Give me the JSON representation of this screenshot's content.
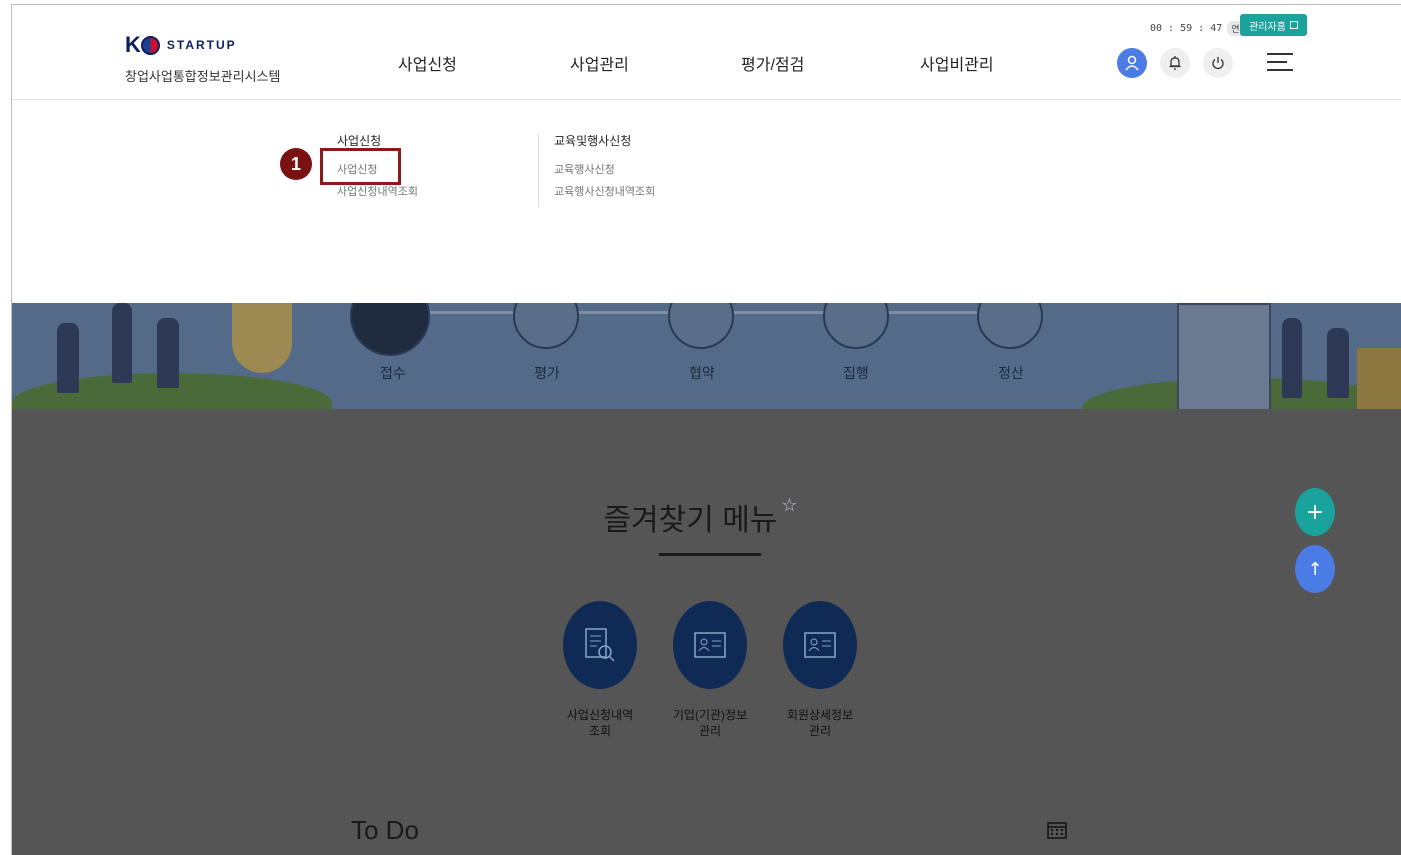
{
  "header": {
    "logo_k": "K",
    "logo_word": "STARTUP",
    "subtitle": "창업사업통합정보관리시스템",
    "nav": [
      "사업신청",
      "사업관리",
      "평가/점검",
      "사업비관리"
    ],
    "timer": "00 : 59 : 47",
    "extend_label": "연장",
    "admin_label": "관리자홈"
  },
  "dropdown": {
    "col1_title": "사업신청",
    "col1_items": [
      "사업신청",
      "사업신청내역조회"
    ],
    "col2_title": "교육및행사신청",
    "col2_items": [
      "교육행사신청",
      "교육행사신청내역조회"
    ],
    "step_badge": "1"
  },
  "banner": {
    "steps": [
      "접수",
      "평가",
      "협약",
      "집행",
      "정산"
    ]
  },
  "favorites": {
    "title": "즐겨찾기 메뉴",
    "star": "☆",
    "items": [
      {
        "line1": "사업신청내역",
        "line2": "조회"
      },
      {
        "line1": "기업(기관)정보",
        "line2": "관리"
      },
      {
        "line1": "회원상세정보",
        "line2": "관리"
      }
    ]
  },
  "todo": {
    "title": "To Do"
  },
  "fabs": {
    "plus": "+",
    "up": "↑"
  },
  "colors": {
    "teal": "#1aa39c",
    "blue": "#4b7be5",
    "navy": "#0e2a55",
    "highlight": "#8b1a1a"
  }
}
